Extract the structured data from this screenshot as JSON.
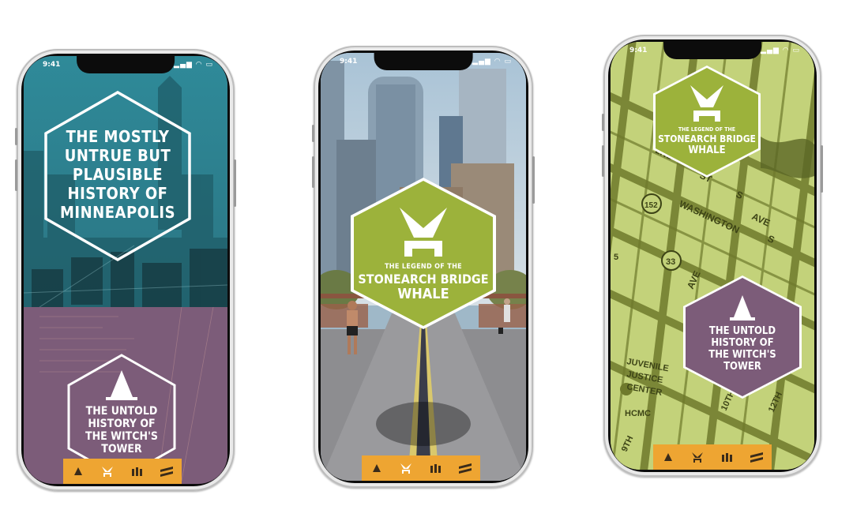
{
  "status": {
    "time": "9:41",
    "icons": "▂▄▆ ◠ ▭"
  },
  "phone1": {
    "hero_title": "THE MOSTLY UNTRUE BUT PLAUSIBLE HISTORY OF MINNEAPOLIS",
    "card_title": "THE UNTOLD HISTORY OF THE WITCH'S TOWER"
  },
  "phone2": {
    "subtitle": "THE LEGEND OF THE",
    "title_line1": "STONEARCH BRIDGE",
    "title_line2": "WHALE"
  },
  "phone3": {
    "subtitle": "THE LEGEND OF THE",
    "title_line1": "STONEARCH BRIDGE",
    "title_line2": "WHALE",
    "card_title": "THE UNTOLD HISTORY OF THE WITCH'S TOWER",
    "map_labels": [
      "2ND",
      "ST",
      "S",
      "WASHINGTON",
      "AVE",
      "S",
      "AVE",
      "152",
      "33",
      "5",
      "JUVENILE",
      "JUSTICE",
      "CENTER",
      "HCMC",
      "10TH",
      "12TH",
      "9TH"
    ]
  },
  "tabbar": {
    "tabs": [
      {
        "name": "witch-tower-tab",
        "icon": "cone"
      },
      {
        "name": "whale-tab",
        "icon": "whale"
      },
      {
        "name": "bottles-tab",
        "icon": "bottles"
      },
      {
        "name": "bridge-tab",
        "icon": "stripes"
      }
    ]
  },
  "colors": {
    "teal": "#2e8695",
    "purple": "#7c5c79",
    "green": "#9cb23b",
    "orange": "#eea532",
    "map": "#c3d27a"
  }
}
